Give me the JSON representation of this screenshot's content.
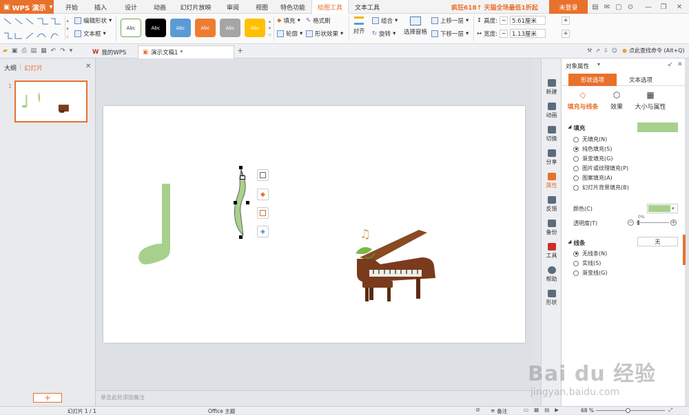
{
  "app": {
    "name": "WPS 演示",
    "promo": "疯狂618↑ 天猫全场最低1折起",
    "login": "未登录"
  },
  "menu_tabs": [
    "开始",
    "插入",
    "设计",
    "动画",
    "幻灯片放映",
    "审阅",
    "视图",
    "特色功能",
    "绘图工具",
    "文本工具"
  ],
  "ribbon": {
    "edit_shape": "编辑形状",
    "text_box": "文本框",
    "style_sample": "Abc",
    "fill": "填充",
    "format_brush": "格式刷",
    "outline": "轮廓",
    "shape_effect": "形状效果",
    "align": "对齐",
    "group": "组合",
    "rotate": "旋转",
    "selection_pane": "选择窗格",
    "bring_forward": "上移一层",
    "send_backward": "下移一层",
    "height_label": "高度:",
    "height_value": "5.61厘米",
    "width_label": "宽度:",
    "width_value": "1.13厘米"
  },
  "tabs": {
    "my_wps": "我的WPS",
    "document": "演示文稿1 *",
    "find_command": "点此查找命令 (Alt+Q)"
  },
  "left_pane": {
    "outline_tab": "大纲",
    "slides_tab": "幻灯片",
    "slide_number": "1",
    "add_label": "+"
  },
  "notes_placeholder": "单击此处添加备注",
  "side_strip": [
    "新建",
    "动画",
    "切换",
    "分享",
    "属性",
    "反馈",
    "备份",
    "工具",
    "帮助",
    "形状"
  ],
  "props": {
    "title": "对象属性",
    "tab_shape": "形状选项",
    "tab_text": "文本选项",
    "sub_fill_line": "填充与线条",
    "sub_effect": "效果",
    "sub_size": "大小与属性",
    "fill_section": "填充",
    "fill_options": [
      "无填充(N)",
      "纯色填充(S)",
      "渐变填充(G)",
      "图片或纹理填充(P)",
      "图案填充(A)",
      "幻灯片背景填充(B)"
    ],
    "fill_selected": 1,
    "color_label": "颜色(C)",
    "transparency_label": "透明度(T)",
    "transparency_value": "0%",
    "line_section": "线条",
    "line_value": "无",
    "line_options": [
      "无线条(N)",
      "实线(S)",
      "渐变线(G)"
    ],
    "line_selected": 0
  },
  "status": {
    "slide_counter": "幻灯片 1 / 1",
    "theme": "Office 主题",
    "notes": "备注",
    "zoom": "68 %"
  },
  "colors": {
    "accent": "#e8712c",
    "shape_fill": "#a8d08d",
    "promo": "#e8712c"
  },
  "watermark": {
    "logo": "Bai du 经验",
    "url": "jingyan.baidu.com"
  }
}
